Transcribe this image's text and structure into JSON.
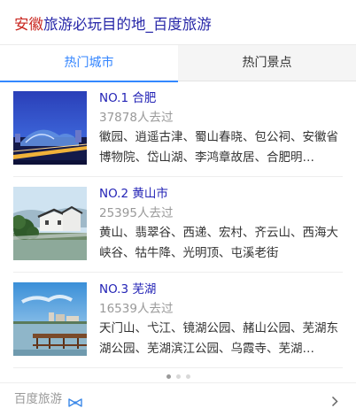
{
  "header": {
    "title_highlight": "安徽",
    "title_rest": "旅游必玩目的地_百度旅游"
  },
  "tabs": [
    {
      "label": "热门城市",
      "active": true
    },
    {
      "label": "热门景点",
      "active": false
    }
  ],
  "items": [
    {
      "rank": "NO.1",
      "city": "合肥",
      "visits": "37878人去过",
      "desc": "徽园、逍遥古津、蜀山春晓、包公祠、安徽省博物院、岱山湖、李鸿章故居、合肥明…"
    },
    {
      "rank": "NO.2",
      "city": "黄山市",
      "visits": "25395人去过",
      "desc": "黄山、翡翠谷、西递、宏村、齐云山、西海大峡谷、牯牛降、光明顶、屯溪老街"
    },
    {
      "rank": "NO.3",
      "city": "芜湖",
      "visits": "16539人去过",
      "desc": "天门山、弋江、镜湖公园、赭山公园、芜湖东湖公园、芜湖滨江公园、乌霞寺、芜湖…"
    }
  ],
  "pagination": {
    "pages": 3,
    "current": 1
  },
  "footer": {
    "brand": "百度旅游",
    "logo_icon": "baidu-travel-bow-icon",
    "arrow_icon": "chevron-right-icon"
  },
  "colors": {
    "title_highlight": "#c9261f",
    "title_link": "#2626a8",
    "tab_active": "#3385ff",
    "rank_link": "#2424b6",
    "muted": "#999999"
  }
}
